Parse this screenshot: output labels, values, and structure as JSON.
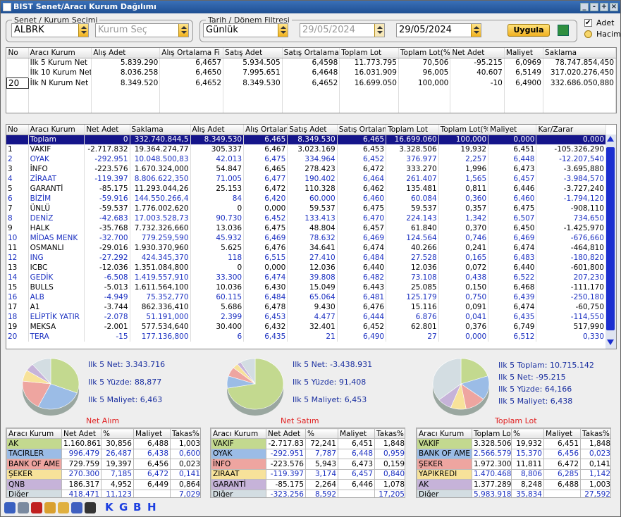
{
  "window": {
    "title": "BIST Senet/Aracı Kurum Dağılımı"
  },
  "filters": {
    "senet_legend": "Senet / Kurum Seçimi",
    "senet_value": "ALBRK",
    "kurum_placeholder": "Kurum Seç",
    "tarih_legend": "Tarih / Dönem Filtresi",
    "period": "Günlük",
    "date_from": "29/05/2024",
    "date_to": "29/05/2024",
    "apply": "Uygula",
    "opt_adet": "Adet",
    "opt_hacim": "Hacim"
  },
  "top_table": {
    "headers": [
      "No",
      "Aracı Kurum",
      "Alış Adet",
      "Alış Ortalama Fi",
      "Satış Adet",
      "Satış Ortalama Fi",
      "Toplam Lot",
      "Toplam Lot(%",
      "Net Adet",
      "Maliyet",
      "Saklama"
    ],
    "rows": [
      [
        "",
        "İlk 5 Kurum Net",
        "5.839.290",
        "6,4657",
        "5.934.505",
        "6,4598",
        "11.773.795",
        "70,506",
        "-95.215",
        "6,0969",
        "78.747.854,450"
      ],
      [
        "",
        "İlk 10 Kurum Net",
        "8.036.258",
        "6,4650",
        "7.995.651",
        "6,4648",
        "16.031.909",
        "96,005",
        "40.607",
        "6,5149",
        "317.020.276,450"
      ],
      [
        "20",
        "İlk N Kurum Net",
        "8.349.520",
        "6,4652",
        "8.349.530",
        "6,4652",
        "16.699.050",
        "100,000",
        "-10",
        "6,4900",
        "332.686.050,880"
      ]
    ]
  },
  "main_table": {
    "headers": [
      "No",
      "Aracı Kurum",
      "Net Adet",
      "Saklama",
      "Alış Adet",
      "Alış Ortalam",
      "Satış Adet",
      "Satış Ortalam",
      "Toplam Lot",
      "Toplam Lot(%",
      "Maliyet",
      "Kar/Zarar"
    ],
    "rows": [
      [
        "",
        "Toplam",
        "0",
        "332.740.844,5",
        "8.349.530",
        "6,465",
        "8.349.530",
        "6,465",
        "16.699.060",
        "100,000",
        "0,000",
        "0,000"
      ],
      [
        "1",
        "VAKIF",
        "-2.717.832",
        "19.364.274,77",
        "305.337",
        "6,467",
        "3.023.169",
        "6,453",
        "3.328.506",
        "19,932",
        "6,451",
        "-105.326,290"
      ],
      [
        "2",
        "OYAK",
        "-292.951",
        "10.048.500,83",
        "42.013",
        "6,475",
        "334.964",
        "6,452",
        "376.977",
        "2,257",
        "6,448",
        "-12.207,540"
      ],
      [
        "3",
        "İNFO",
        "-223.576",
        "1.670.324,000",
        "54.847",
        "6,465",
        "278.423",
        "6,472",
        "333.270",
        "1,996",
        "6,473",
        "-3.695,880"
      ],
      [
        "4",
        "ZİRAAT",
        "-119.397",
        "8.806.622,350",
        "71.005",
        "6,477",
        "190.402",
        "6,464",
        "261.407",
        "1,565",
        "6,457",
        "-3.984,570"
      ],
      [
        "5",
        "GARANTİ",
        "-85.175",
        "11.293.044,26",
        "25.153",
        "6,472",
        "110.328",
        "6,462",
        "135.481",
        "0,811",
        "6,446",
        "-3.727,240"
      ],
      [
        "6",
        "BİZİM",
        "-59.916",
        "144.550.266,4",
        "84",
        "6,420",
        "60.000",
        "6,460",
        "60.084",
        "0,360",
        "6,460",
        "-1.794,120"
      ],
      [
        "7",
        "ÜNLÜ",
        "-59.537",
        "1.776.002,620",
        "0",
        "0,000",
        "59.537",
        "6,475",
        "59.537",
        "0,357",
        "6,475",
        "-908,110"
      ],
      [
        "8",
        "DENİZ",
        "-42.683",
        "17.003.528,73",
        "90.730",
        "6,452",
        "133.413",
        "6,470",
        "224.143",
        "1,342",
        "6,507",
        "734,650"
      ],
      [
        "9",
        "HALK",
        "-35.768",
        "7.732.326,660",
        "13.036",
        "6,475",
        "48.804",
        "6,457",
        "61.840",
        "0,370",
        "6,450",
        "-1.425,970"
      ],
      [
        "10",
        "MİDAS MENK",
        "-32.700",
        "779.259,590",
        "45.932",
        "6,469",
        "78.632",
        "6,469",
        "124.564",
        "0,746",
        "6,469",
        "-676,660"
      ],
      [
        "11",
        "OSMANLI",
        "-29.016",
        "1.930.370,960",
        "5.625",
        "6,476",
        "34.641",
        "6,474",
        "40.266",
        "0,241",
        "6,474",
        "-464,810"
      ],
      [
        "12",
        "ING",
        "-27.292",
        "424.345,370",
        "118",
        "6,515",
        "27.410",
        "6,484",
        "27.528",
        "0,165",
        "6,483",
        "-180,820"
      ],
      [
        "13",
        "ICBC",
        "-12.036",
        "1.351.084,800",
        "0",
        "0,000",
        "12.036",
        "6,440",
        "12.036",
        "0,072",
        "6,440",
        "-601,800"
      ],
      [
        "14",
        "GEDİK",
        "-6.508",
        "1.419.557,910",
        "33.300",
        "6,474",
        "39.808",
        "6,482",
        "73.108",
        "0,438",
        "6,522",
        "207,230"
      ],
      [
        "15",
        "BULLS",
        "-5.013",
        "1.611.564,100",
        "10.036",
        "6,430",
        "15.049",
        "6,443",
        "25.085",
        "0,150",
        "6,468",
        "-111,170"
      ],
      [
        "16",
        "ALB",
        "-4.949",
        "75.352,770",
        "60.115",
        "6,484",
        "65.064",
        "6,481",
        "125.179",
        "0,750",
        "6,439",
        "-250,180"
      ],
      [
        "17",
        "A1",
        "-3.744",
        "862.336,410",
        "5.686",
        "6,478",
        "9.430",
        "6,476",
        "15.116",
        "0,091",
        "6,474",
        "-60,750"
      ],
      [
        "18",
        "ELİPTİK YATIR",
        "-2.078",
        "51.191,000",
        "2.399",
        "6,453",
        "4.477",
        "6,444",
        "6.876",
        "0,041",
        "6,435",
        "-114,550"
      ],
      [
        "19",
        "MEKSA",
        "-2.001",
        "577.534,640",
        "30.400",
        "6,432",
        "32.401",
        "6,452",
        "62.801",
        "0,376",
        "6,749",
        "517,990"
      ],
      [
        "20",
        "TERA",
        "-15",
        "177.136,800",
        "6",
        "6,435",
        "21",
        "6,490",
        "27",
        "0,000",
        "6,512",
        "0,330"
      ]
    ]
  },
  "summary": [
    {
      "title": "Net Alım",
      "info": [
        "Ilk 5 Net: 3.343.716",
        "Ilk 5 Yüzde: 88,877",
        "Ilk 5 Maliyet: 6,463"
      ],
      "headers": [
        "Aracı Kurum",
        "Net Adet",
        "%",
        "Maliyet",
        "Takas%"
      ],
      "rows": [
        [
          "AK",
          "1.160.861",
          "30,856",
          "6,488",
          "1,003"
        ],
        [
          "TACİRLER",
          "996.479",
          "26,487",
          "6,438",
          "0,600"
        ],
        [
          "BANK OF AME",
          "729.759",
          "19,397",
          "6,456",
          "0,023"
        ],
        [
          "ŞEKER",
          "270.300",
          "7,185",
          "6,472",
          "0,141"
        ],
        [
          "QNB",
          "186.317",
          "4,952",
          "6,449",
          "0,864"
        ],
        [
          "Diğer",
          "418.471",
          "11,123",
          "",
          "7,029"
        ]
      ]
    },
    {
      "title": "Net Satım",
      "info": [
        "Ilk 5 Net: -3.438.931",
        "Ilk 5 Yüzde: 91,408",
        "Ilk 5 Maliyet: 6,453"
      ],
      "headers": [
        "Aracı Kurum",
        "Net Adet",
        "%",
        "Maliyet",
        "Takas%"
      ],
      "rows": [
        [
          "VAKIF",
          "-2.717.83",
          "72,241",
          "6,451",
          "1,848"
        ],
        [
          "OYAK",
          "-292.951",
          "7,787",
          "6,448",
          "0,959"
        ],
        [
          "İNFO",
          "-223.576",
          "5,943",
          "6,473",
          "0,159"
        ],
        [
          "ZİRAAT",
          "-119.397",
          "3,174",
          "6,457",
          "0,840"
        ],
        [
          "GARANTİ",
          "-85.175",
          "2,264",
          "6,446",
          "1,078"
        ],
        [
          "Diğer",
          "-323.256",
          "8,592",
          "",
          "17,205"
        ]
      ]
    },
    {
      "title": "Toplam Lot",
      "info": [
        "Ilk 5 Toplam: 10.715.142",
        "Ilk 5 Net: -95.215",
        "Ilk 5 Yüzde: 64,166",
        "Ilk 5 Maliyet: 6,438"
      ],
      "headers": [
        "Aracı Kurum",
        "Toplam Lot",
        "%",
        "Maliyet",
        "Takas%"
      ],
      "rows": [
        [
          "VAKIF",
          "3.328.506",
          "19,932",
          "6,451",
          "1,848"
        ],
        [
          "BANK OF AME",
          "2.566.579",
          "15,370",
          "6,456",
          "0,023"
        ],
        [
          "ŞEKER",
          "1.972.300",
          "11,811",
          "6,472",
          "0,141"
        ],
        [
          "YAPIKREDİ",
          "1.470.468",
          "8,806",
          "6,285",
          "1,142"
        ],
        [
          "AK",
          "1.377.289",
          "8,248",
          "6,488",
          "1,003"
        ],
        [
          "Diğer",
          "5.983.918",
          "35,834",
          "",
          "27,592"
        ]
      ]
    }
  ],
  "colors": {
    "green": "#c3d98f",
    "blue": "#9bbce6",
    "red": "#eea5a0",
    "yellow": "#f7e29a",
    "purple": "#c6b3d9",
    "gray": "#d3dde2",
    "selected": "#15158a",
    "link": "#1a2fc0"
  },
  "pie_values": [
    [
      30.856,
      26.487,
      19.397,
      7.185,
      4.952,
      11.123
    ],
    [
      72.241,
      7.787,
      5.943,
      3.174,
      2.264,
      8.592
    ],
    [
      19.932,
      15.37,
      11.811,
      8.806,
      8.248,
      35.834
    ]
  ],
  "toolbar": {
    "letters": [
      "K",
      "G",
      "B",
      "H"
    ],
    "icons": [
      "search-icon",
      "chart-icon",
      "m-icon",
      "user-icon",
      "folder-icon",
      "save-icon",
      "bank-icon"
    ]
  }
}
